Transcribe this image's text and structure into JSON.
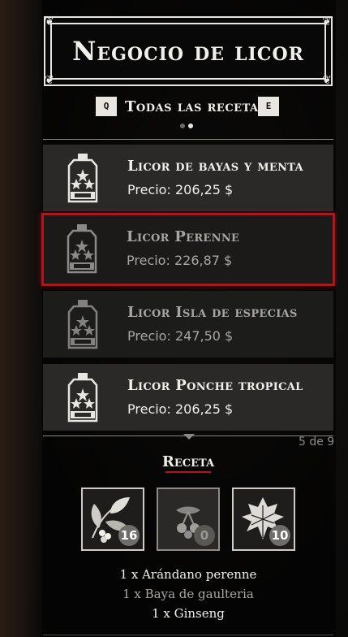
{
  "title": "Negocio de licor",
  "tabs": {
    "left_key": "Q",
    "label": "Todas las recetas",
    "right_key": "E"
  },
  "items": [
    {
      "name": "Licor de bayas y menta",
      "price_label": "Precio:",
      "price": "206,25 $",
      "state": "normal"
    },
    {
      "name": "Licor Perenne",
      "price_label": "Precio:",
      "price": "226,87 $",
      "state": "selected"
    },
    {
      "name": "Licor Isla de especias",
      "price_label": "Precio:",
      "price": "247,50 $",
      "state": "dim"
    },
    {
      "name": "Licor Ponche tropical",
      "price_label": "Precio:",
      "price": "206,25 $",
      "state": "normal"
    }
  ],
  "count": "5 de 9",
  "recipe": {
    "title": "Receta",
    "ingredients": [
      {
        "icon": "berry-plant-icon",
        "qty": "16",
        "available": true
      },
      {
        "icon": "cherry-berry-icon",
        "qty": "0",
        "available": false
      },
      {
        "icon": "ginseng-leaf-icon",
        "qty": "10",
        "available": true
      }
    ],
    "requirements": [
      {
        "text": "1 x Arándano perenne",
        "color": "#f1efea"
      },
      {
        "text": "1 x Baya de gaulteria",
        "color": "#a9a6a1"
      },
      {
        "text": "1 x Ginseng",
        "color": "#f1efea"
      }
    ]
  },
  "colors": {
    "accent_red": "#b3141a",
    "text": "#f1efea",
    "dim_text": "#a9a6a1"
  }
}
